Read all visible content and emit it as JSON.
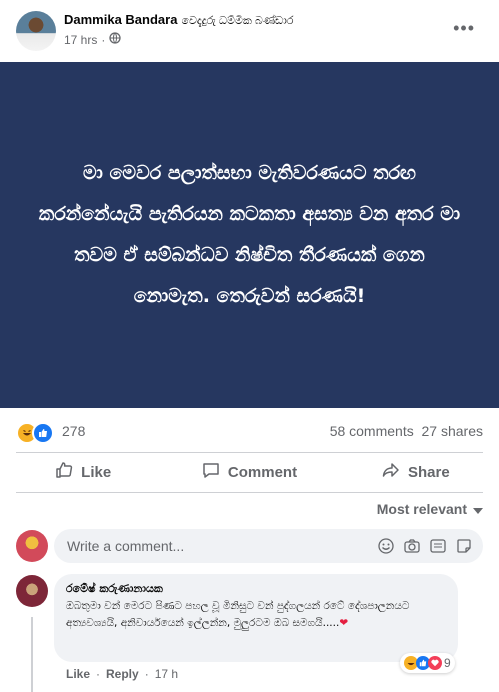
{
  "post": {
    "author": "Dammika Bandara",
    "author_secondary": "වෙදැදුරු ධම්මික බණ්ඩාර",
    "time": "17 hrs",
    "separator": "·",
    "image_text": "මා මෙවර පලාත්සභා මැතිවරණයට තරඟ කරන්නේයැයි පැතිරයන කටකතා අසත්‍ය වන අතර මා තවම ඒ සම්බන්ධව නිෂ්චිත තීරණයක් ගෙන නොමැත. තෙරුවන් සරණයි!",
    "reaction_count": "278",
    "comments_count": "58 comments",
    "shares_count": "27 shares"
  },
  "actions": {
    "like": "Like",
    "comment": "Comment",
    "share": "Share"
  },
  "sort_label": "Most relevant",
  "composer": {
    "placeholder": "Write a comment..."
  },
  "comment": {
    "name": "රමේෂ් කරුණානායක",
    "text": "ඔබතුමා වන් මෙරට පිණට පහල වූ මිනිසුට වන් පුද්ගලයන් රටේ දේශපාලනයට අත්‍යවශ්‍යයි, අනිවාර්යයෙන් ඉල්ලන්න, මුලුරටම ඔබ සමගයි.....",
    "heart": "❤",
    "reaction_count": "9",
    "like_label": "Like",
    "reply_label": "Reply",
    "dot": "·",
    "time": "17 h"
  },
  "colors": {
    "post_background": "#263760",
    "like_blue": "#1877f2",
    "haha_yellow": "#f7b125",
    "love_red": "#f33e58"
  }
}
